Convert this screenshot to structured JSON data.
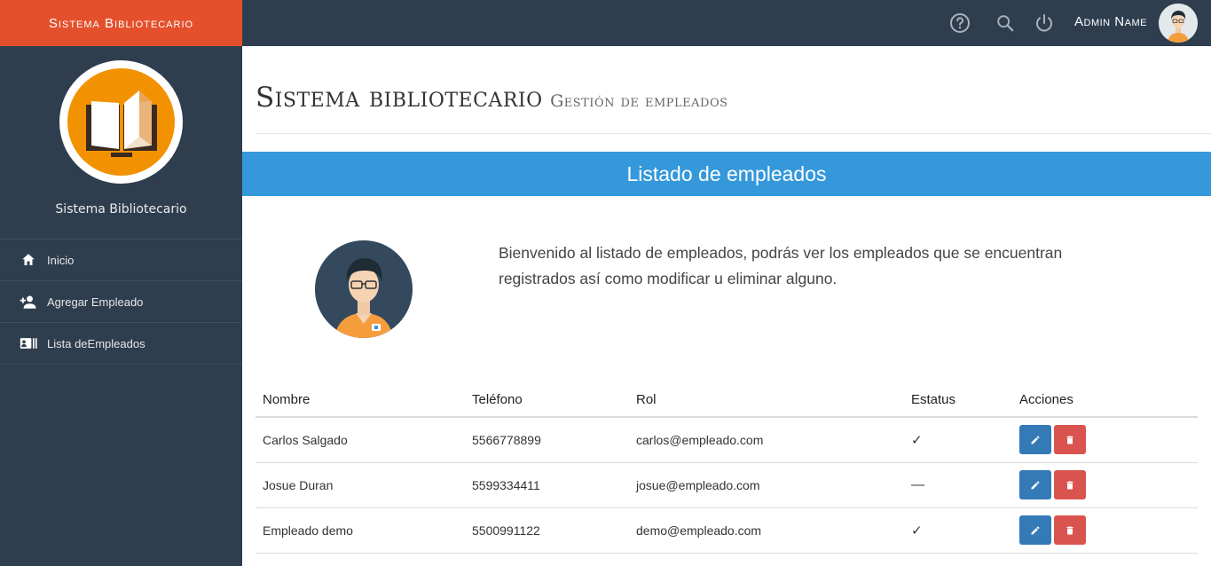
{
  "app": {
    "brand": "Sistema Bibliotecario"
  },
  "topbar": {
    "icons": [
      "help-circle-icon",
      "search-icon",
      "power-icon"
    ],
    "admin_name": "Admin Name"
  },
  "sidebar": {
    "title": "Sistema Bibliotecario",
    "items": [
      {
        "label": "Inicio",
        "icon": "home-icon"
      },
      {
        "label": "Agregar Empleado",
        "icon": "person-add-icon"
      },
      {
        "label": "Lista deEmpleados",
        "icon": "id-card-icon"
      }
    ]
  },
  "page": {
    "title": "Sistema bibliotecario",
    "subtitle": "Gestión de empleados"
  },
  "panel": {
    "title": "Listado de empleados",
    "intro": "Bienvenido al listado de empleados, podrás ver los empleados que se encuentran registrados así como modificar u eliminar alguno."
  },
  "table": {
    "headers": [
      "Nombre",
      "Teléfono",
      "Rol",
      "Estatus",
      "Acciones"
    ],
    "rows": [
      {
        "nombre": "Carlos Salgado",
        "telefono": "5566778899",
        "rol": "carlos@empleado.com",
        "estatus": "✓"
      },
      {
        "nombre": "Josue Duran",
        "telefono": "5599334411",
        "rol": "josue@empleado.com",
        "estatus": "—"
      },
      {
        "nombre": "Empleado demo",
        "telefono": "5500991122",
        "rol": "demo@empleado.com",
        "estatus": "✓"
      }
    ]
  },
  "colors": {
    "brand": "#e4502b",
    "nav": "#2f3e4f",
    "panel": "#3498db",
    "edit": "#337ab7",
    "delete": "#d9534f",
    "logo": "#f39200"
  }
}
